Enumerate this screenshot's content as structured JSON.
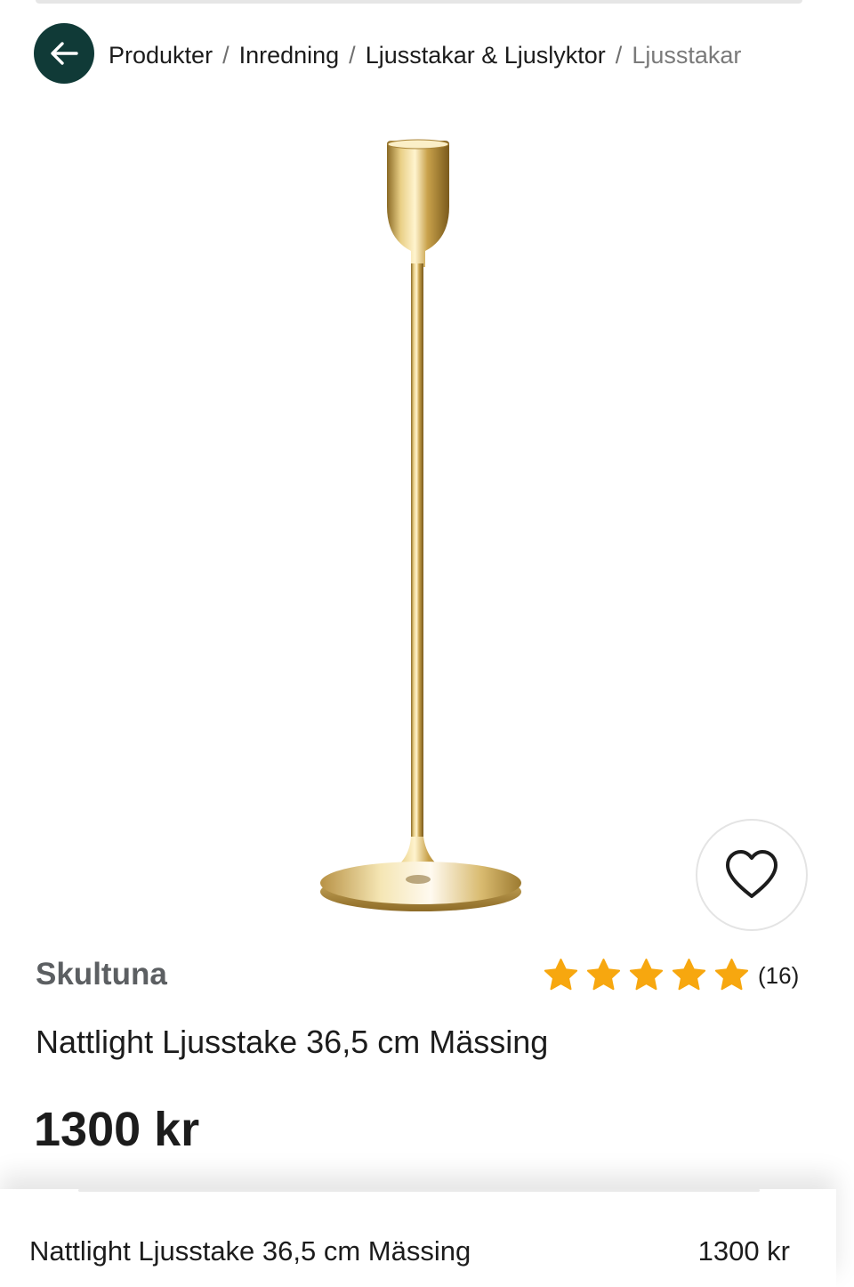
{
  "breadcrumb": {
    "items": [
      "Produkter",
      "Inredning",
      "Ljusstakar & Ljuslyktor"
    ],
    "current": "Ljusstakar",
    "separator": "/"
  },
  "icons": {
    "back": "arrow-left-icon",
    "favorite": "heart-icon",
    "rating": "star-icon"
  },
  "product": {
    "brand": "Skultuna",
    "name": "Nattlight Ljusstake 36,5 cm Mässing",
    "price": "1300 kr",
    "rating": {
      "stars": 5,
      "max": 5,
      "count_label": "(16)"
    },
    "image_description": "brass candlestick"
  },
  "sticky_bar": {
    "name": "Nattlight Ljusstake 36,5 cm Mässing",
    "price": "1300 kr"
  },
  "colors": {
    "accent": "#103a37",
    "star": "#f7a70f",
    "brand_text": "#5c5f62"
  }
}
